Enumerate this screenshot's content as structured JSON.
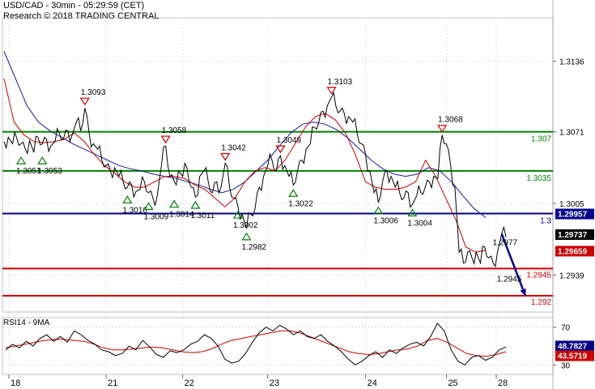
{
  "header": {
    "title": "USD/CAD - 30min - 05:29:59 (CET)",
    "subtitle": "Research © 2018 TRADING CENTRAL"
  },
  "rsi_panel": {
    "title": "RSI14 - 9MA"
  },
  "colors": {
    "price": "#000000",
    "ma_fast": "#cc0000",
    "ma_slow": "#1a1a99",
    "support": "#cc0000",
    "pivot": "#00008b",
    "resistance": "#008000"
  },
  "chart_data": [
    {
      "type": "line",
      "title": "USD/CAD - 30min - 05:29:59 (CET)",
      "x_ticks": [
        "18",
        "21",
        "22",
        "23",
        "24",
        "25",
        "28"
      ],
      "y_ticks": [
        1.3136,
        1.3071,
        1.3005,
        1.2939
      ],
      "ylim": [
        1.2905,
        1.3176
      ],
      "series": [
        {
          "role": "price",
          "values": [
            1.3062,
            1.3066,
            1.306,
            1.3065,
            1.306,
            1.3055,
            1.3063,
            1.3052,
            1.3066,
            1.306,
            1.3064,
            1.3058,
            1.3062,
            1.307,
            1.3065,
            1.3072,
            1.3068,
            1.308,
            1.3072,
            1.3093,
            1.307,
            1.306,
            1.3055,
            1.3045,
            1.304,
            1.3035,
            1.3038,
            1.303,
            1.3025,
            1.302,
            1.3022,
            1.3016,
            1.3018,
            1.3025,
            1.3015,
            1.301,
            1.3012,
            1.304,
            1.3058,
            1.303,
            1.3025,
            1.3035,
            1.303,
            1.3038,
            1.302,
            1.3011,
            1.303,
            1.3035,
            1.3025,
            1.3015,
            1.3025,
            1.302,
            1.3042,
            1.302,
            1.301,
            1.3002,
            1.2995,
            1.2982,
            1.2995,
            1.3,
            1.302,
            1.303,
            1.304,
            1.3045,
            1.3035,
            1.3049,
            1.304,
            1.303,
            1.3022,
            1.3035,
            1.3045,
            1.3055,
            1.306,
            1.3075,
            1.308,
            1.309,
            1.3095,
            1.3103,
            1.3095,
            1.309,
            1.3088,
            1.3085,
            1.308,
            1.307,
            1.306,
            1.305,
            1.3035,
            1.3015,
            1.3006,
            1.3025,
            1.3035,
            1.303,
            1.302,
            1.3015,
            1.301,
            1.3015,
            1.3004,
            1.3012,
            1.3015,
            1.302,
            1.3025,
            1.303,
            1.3028,
            1.3068,
            1.306,
            1.304,
            1.302,
            1.296,
            1.295,
            1.296,
            1.2955,
            1.296,
            1.295,
            1.2965,
            1.2955,
            1.295,
            1.296,
            1.2977,
            1.2974
          ]
        },
        {
          "role": "ma_fast",
          "values": [
            1.312,
            1.308,
            1.3068,
            1.3062,
            1.3061,
            1.3062,
            1.3064,
            1.307,
            1.3062,
            1.305,
            1.304,
            1.3033,
            1.3025,
            1.302,
            1.302,
            1.3025,
            1.303,
            1.303,
            1.3028,
            1.3022,
            1.3018,
            1.301,
            1.3002,
            1.301,
            1.3025,
            1.3035,
            1.3038,
            1.3035,
            1.3045,
            1.306,
            1.3075,
            1.3085,
            1.3088,
            1.3082,
            1.307,
            1.305,
            1.3025,
            1.302,
            1.3018,
            1.3018,
            1.302,
            1.3025,
            1.3045,
            1.303,
            1.301,
            1.299,
            1.2965,
            1.296,
            1.2962
          ]
        },
        {
          "role": "ma_slow",
          "values": [
            1.3145,
            1.312,
            1.3095,
            1.308,
            1.3072,
            1.3066,
            1.306,
            1.3055,
            1.305,
            1.3045,
            1.304,
            1.3037,
            1.3035,
            1.3032,
            1.303,
            1.3028,
            1.3025,
            1.3022,
            1.3018,
            1.3015,
            1.3018,
            1.3025,
            1.3035,
            1.3045,
            1.3058,
            1.307,
            1.3078,
            1.308,
            1.3078,
            1.3073,
            1.3065,
            1.3055,
            1.3045,
            1.3037,
            1.3032,
            1.303,
            1.3032,
            1.3038,
            1.3035,
            1.3025,
            1.3012,
            1.3,
            1.2992
          ]
        }
      ],
      "levels": [
        {
          "value": 1.3071,
          "label": "1.307",
          "kind": "resistance"
        },
        {
          "value": 1.3035,
          "label": "1.3035",
          "kind": "resistance"
        },
        {
          "value": 1.29957,
          "label": "1.3",
          "kind": "pivot"
        },
        {
          "value": 1.2945,
          "label": "1.2945",
          "kind": "support"
        },
        {
          "value": 1.292,
          "label": "1.292",
          "kind": "support"
        }
      ],
      "price_tags": [
        {
          "label": "1.29957",
          "value": 1.29957,
          "bg": "#00008b"
        },
        {
          "label": "1.29737",
          "value": 1.29737,
          "bg": "#000000"
        },
        {
          "label": "1.29659",
          "value": 1.29659,
          "bg": "#cc0000"
        }
      ],
      "annotations": [
        {
          "label": "1.3093",
          "x": 19,
          "value": 1.3093,
          "marker": "down"
        },
        {
          "label": "1.3058",
          "x": 38,
          "value": 1.3058,
          "marker": "down"
        },
        {
          "label": "1.3042",
          "x": 52,
          "value": 1.3042,
          "marker": "down"
        },
        {
          "label": "1.3049",
          "x": 65,
          "value": 1.3049,
          "marker": "down"
        },
        {
          "label": "1.3103",
          "x": 77,
          "value": 1.3103,
          "marker": "down"
        },
        {
          "label": "1.3068",
          "x": 103,
          "value": 1.3068,
          "marker": "down"
        },
        {
          "label": "1.3051",
          "x": 4,
          "value": 1.3052,
          "marker": "up"
        },
        {
          "label": "1.3053",
          "x": 9,
          "value": 1.3052,
          "marker": "up"
        },
        {
          "label": "1.3016",
          "x": 29,
          "value": 1.3016,
          "marker": "up"
        },
        {
          "label": "1.3009",
          "x": 34,
          "value": 1.301,
          "marker": "up"
        },
        {
          "label": "1.3014",
          "x": 40,
          "value": 1.3012,
          "marker": "up"
        },
        {
          "label": "1.3011",
          "x": 45,
          "value": 1.3011,
          "marker": "up"
        },
        {
          "label": "1.3002",
          "x": 55,
          "value": 1.3002,
          "marker": "up"
        },
        {
          "label": "1.2982",
          "x": 57,
          "value": 1.2982,
          "marker": "up"
        },
        {
          "label": "1.3022",
          "x": 68,
          "value": 1.3022,
          "marker": "up"
        },
        {
          "label": "1.3006",
          "x": 88,
          "value": 1.3006,
          "marker": "up"
        },
        {
          "label": "1.3004",
          "x": 96,
          "value": 1.3004,
          "marker": "up"
        },
        {
          "label": "1.2977",
          "x": 116,
          "value": 1.2977,
          "marker": "none"
        },
        {
          "label": "1.2945",
          "x": 117,
          "value": 1.2945,
          "marker": "none"
        }
      ],
      "projection": {
        "from": [
          117,
          1.2977
        ],
        "to": [
          121,
          1.292
        ]
      }
    },
    {
      "type": "line",
      "title": "RSI14 - 9MA",
      "y_ticks": [
        70,
        30
      ],
      "ylim": [
        20,
        80
      ],
      "series": [
        {
          "name": "RSI14",
          "values": [
            46,
            52,
            48,
            55,
            50,
            58,
            62,
            55,
            60,
            54,
            66,
            62,
            56,
            52,
            46,
            44,
            40,
            42,
            50,
            46,
            56,
            49,
            41,
            38,
            45,
            43,
            46,
            52,
            55,
            62,
            58,
            50,
            36,
            32,
            34,
            42,
            54,
            64,
            70,
            66,
            72,
            68,
            62,
            66,
            60,
            58,
            62,
            55,
            50,
            44,
            36,
            30,
            34,
            40,
            44,
            38,
            46,
            42,
            48,
            52,
            54,
            50,
            60,
            74,
            66,
            46,
            34,
            30,
            38,
            40,
            35,
            38,
            46,
            49
          ]
        },
        {
          "name": "9MA",
          "values": [
            48,
            50,
            52,
            54,
            56,
            57,
            57,
            56,
            55,
            52,
            48,
            46,
            46,
            47,
            48,
            49,
            48,
            46,
            44,
            43,
            44,
            47,
            52,
            56,
            58,
            60,
            62,
            64,
            66,
            66,
            64,
            60,
            56,
            52,
            48,
            44,
            42,
            41,
            42,
            44,
            46,
            47,
            50,
            56,
            58,
            54,
            48,
            42,
            40,
            39,
            41,
            44
          ]
        }
      ],
      "price_tags": [
        {
          "label": "48.7827",
          "value": 48.78,
          "bg": "#00008b"
        },
        {
          "label": "43.5719",
          "value": 43.57,
          "bg": "#cc0000"
        }
      ]
    }
  ]
}
